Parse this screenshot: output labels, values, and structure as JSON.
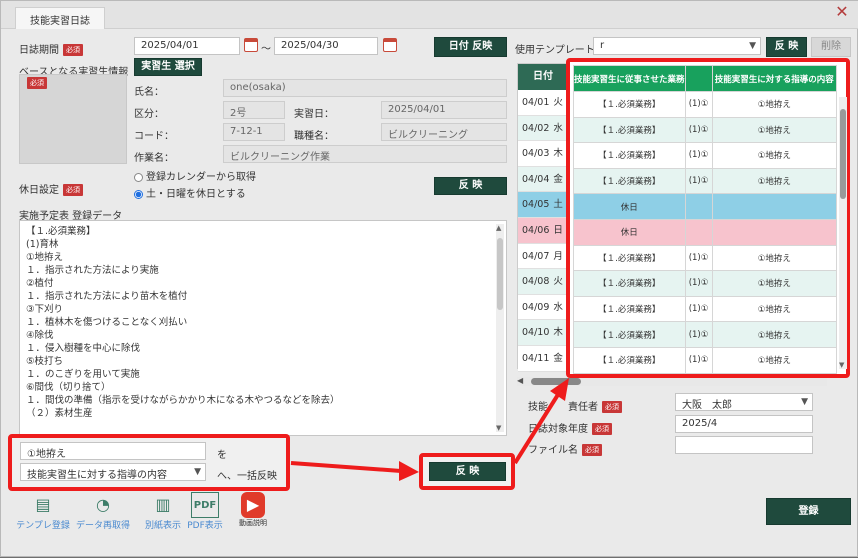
{
  "window": {
    "title": "技能実習日誌"
  },
  "period": {
    "label": "日誌期間",
    "required": "必須",
    "from": "2025/04/01",
    "tilde": "〜",
    "to": "2025/04/30",
    "reflect_date_btn": "日付 反映"
  },
  "template": {
    "label": "使用テンプレート",
    "value": "r",
    "reflect_btn": "反 映",
    "delete_btn": "削除"
  },
  "trainee": {
    "base_label": "ベースとなる実習生情報",
    "required": "必須",
    "select_btn": "実習生 選択",
    "name_label": "氏名：",
    "name": "one(osaka)",
    "class_label": "区分：",
    "class": "2号",
    "date_label": "実習日：",
    "date": "2025/04/01",
    "code_label": "コード：",
    "code": "7-12-1",
    "job_label": "職種名：",
    "job": "ビルクリーニング",
    "work_label": "作業名：",
    "work": "ビルクリーニング作業"
  },
  "holiday": {
    "label": "休日設定",
    "required": "必須",
    "opt1": "登録カレンダーから取得",
    "opt2": "土・日曜を休日とする",
    "reflect_btn": "反 映"
  },
  "schedule": {
    "label": "実施予定表 登録データ",
    "lines": [
      "【１.必須業務】",
      "(1)育林",
      "①地拵え",
      "１．指示された方法により実施",
      "②植付",
      "１．指示された方法により苗木を植付",
      "③下刈り",
      "１．植林木を傷つけることなく刈払い",
      "④除伐",
      "１．侵入樹種を中心に除伐",
      "⑤枝打ち",
      "１．のこぎりを用いて実施",
      "⑥間伐（切り捨て）",
      "１．間伐の準備（指示を受けながらかかり木になる木やつるなどを除去）",
      "（２）素材生産"
    ]
  },
  "bulk": {
    "text_value": "①地拵え",
    "particle": "を",
    "target_value": "技能実習生に対する指導の内容",
    "suffix": "へ、一括反映",
    "reflect_btn": "反 映"
  },
  "table": {
    "col_date": "日付",
    "col_task": "技能実習生に従事させた業務",
    "col_guide": "技能実習生に対する指導の内容",
    "rows": [
      {
        "date": "04/01",
        "wd": "火",
        "task": "【１.必須業務】",
        "num": "(1)①",
        "guide": "①地拵え",
        "type": "even"
      },
      {
        "date": "04/02",
        "wd": "水",
        "task": "【１.必須業務】",
        "num": "(1)①",
        "guide": "①地拵え",
        "type": "odd"
      },
      {
        "date": "04/03",
        "wd": "木",
        "task": "【１.必須業務】",
        "num": "(1)①",
        "guide": "①地拵え",
        "type": "even"
      },
      {
        "date": "04/04",
        "wd": "金",
        "task": "【１.必須業務】",
        "num": "(1)①",
        "guide": "①地拵え",
        "type": "odd"
      },
      {
        "date": "04/05",
        "wd": "土",
        "task": "休日",
        "num": "",
        "guide": "",
        "type": "sat"
      },
      {
        "date": "04/06",
        "wd": "日",
        "task": "休日",
        "num": "",
        "guide": "",
        "type": "sun"
      },
      {
        "date": "04/07",
        "wd": "月",
        "task": "【１.必須業務】",
        "num": "(1)①",
        "guide": "①地拵え",
        "type": "even"
      },
      {
        "date": "04/08",
        "wd": "火",
        "task": "【１.必須業務】",
        "num": "(1)①",
        "guide": "①地拵え",
        "type": "odd"
      },
      {
        "date": "04/09",
        "wd": "水",
        "task": "【１.必須業務】",
        "num": "(1)①",
        "guide": "①地拵え",
        "type": "even"
      },
      {
        "date": "04/10",
        "wd": "木",
        "task": "【１.必須業務】",
        "num": "(1)①",
        "guide": "①地拵え",
        "type": "odd"
      },
      {
        "date": "04/11",
        "wd": "金",
        "task": "【１.必須業務】",
        "num": "(1)①",
        "guide": "①地拵え",
        "type": "even"
      }
    ]
  },
  "footer": {
    "instructor_label": "技能　　責任者",
    "instructor_req": "必須",
    "instructor": "大阪　太郎",
    "year_label": "日誌対象年度",
    "year_req": "必須",
    "year": "2025/4",
    "file_label": "ファイル名",
    "file_req": "必須",
    "register_btn": "登録"
  },
  "tools": [
    "テンプレ登録",
    "データ再取得",
    "別紙表示",
    "PDF表示",
    "動画説明"
  ],
  "colors": {
    "dark_btn": "#1f4a3d",
    "header_green": "#18a15d",
    "highlight": "#ee1c1c",
    "required": "#c83737"
  }
}
